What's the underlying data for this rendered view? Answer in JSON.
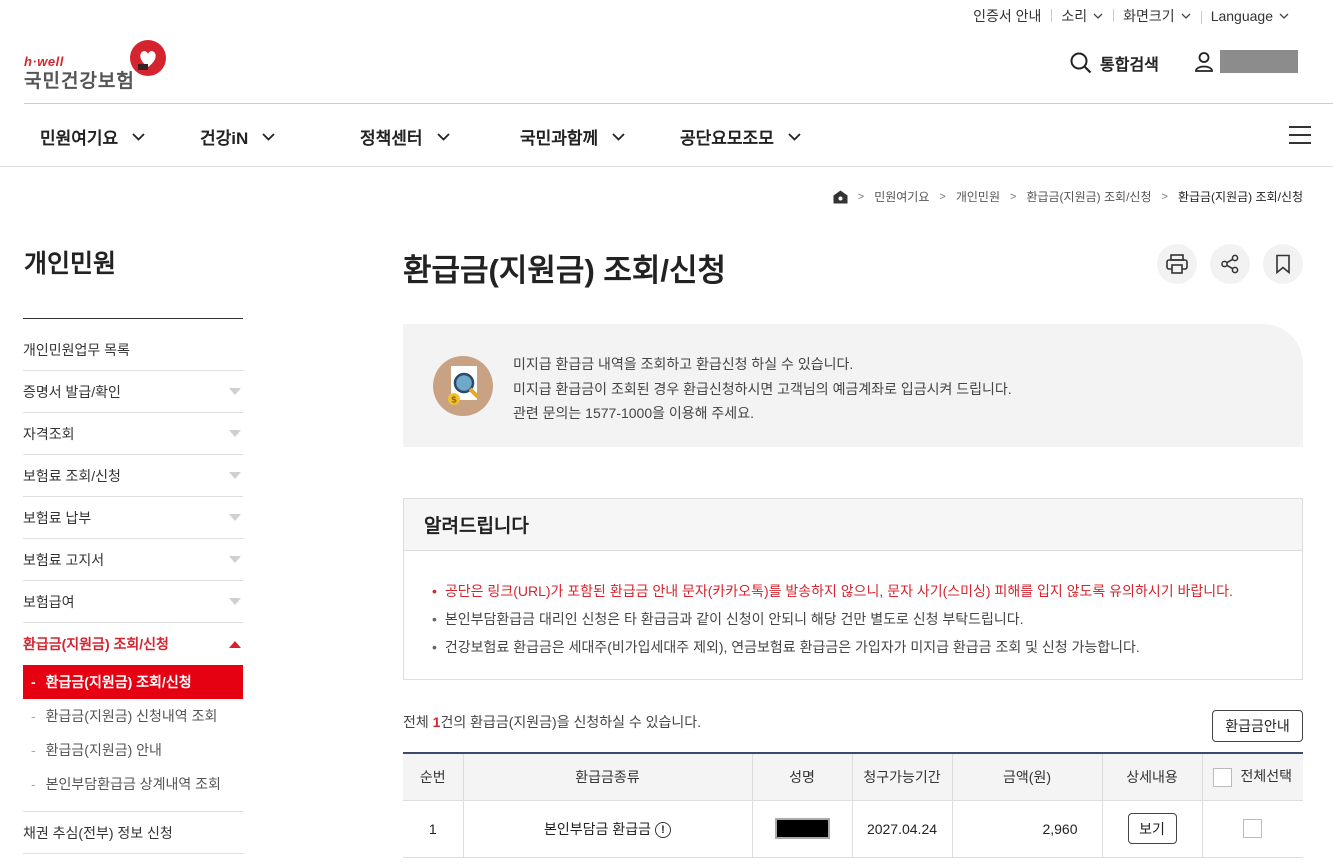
{
  "util": {
    "cert": "인증서 안내",
    "sound": "소리",
    "zoom": "화면크기",
    "language": "Language"
  },
  "logo": {
    "brand": "h·well",
    "name": "국민건강보험"
  },
  "header": {
    "search": "통합검색"
  },
  "gnb": [
    {
      "label": "민원여기요"
    },
    {
      "label": "건강iN"
    },
    {
      "label": "정책센터"
    },
    {
      "label": "국민과함께"
    },
    {
      "label": "공단요모조모"
    }
  ],
  "breadcrumb": [
    "민원여기요",
    "개인민원",
    "환급금(지원금) 조회/신청",
    "환급금(지원금) 조회/신청"
  ],
  "lnb": {
    "title": "개인민원",
    "items": [
      "개인민원업무 목록",
      "증명서 발급/확인",
      "자격조회",
      "보험료 조회/신청",
      "보험료 납부",
      "보험료 고지서",
      "보험급여",
      "환급금(지원금) 조회/신청"
    ],
    "sub": [
      "환급금(지원금) 조회/신청",
      "환급금(지원금) 신청내역 조회",
      "환급금(지원금) 안내",
      "본인부담환급금 상계내역 조회"
    ],
    "last": "채권 추심(전부) 정보 신청"
  },
  "page": {
    "title": "환급금(지원금) 조회/신청"
  },
  "intro": [
    "미지급 환급금 내역을 조회하고 환급신청 하실 수 있습니다.",
    "미지급 환급금이 조회된 경우 환급신청하시면 고객님의 예금계좌로 입금시켜 드립니다.",
    "관련 문의는 1577-1000을 이용해 주세요."
  ],
  "notice": {
    "title": "알려드립니다",
    "items": [
      "공단은 링크(URL)가 포함된 환급금 안내 문자(카카오톡)를 발송하지 않으니, 문자 사기(스미싱) 피해를 입지 않도록 유의하시기 바랍니다.",
      "본인부담환급금 대리인 신청은 타 환급금과 같이 신청이 안되니 해당 건만 별도로 신청 부탁드립니다.",
      "건강보험료 환급금은 세대주(비가입세대주 제외), 연금보험료 환급금은 가입자가 미지급 환급금 조회 및 신청 가능합니다."
    ]
  },
  "count": {
    "prefix": "전체 ",
    "num": "1",
    "suffix": "건의 환급금(지원금)을 신청하실 수 있습니다."
  },
  "guide_button": "환급금안내",
  "table": {
    "headers": [
      "순번",
      "환급금종류",
      "성명",
      "청구가능기간",
      "금액(원)",
      "상세내용",
      "전체선택"
    ],
    "rows": [
      {
        "no": "1",
        "type": "본인부담금 환급금",
        "period": "2027.04.24",
        "amount": "2,960",
        "detail": "보기"
      }
    ]
  }
}
